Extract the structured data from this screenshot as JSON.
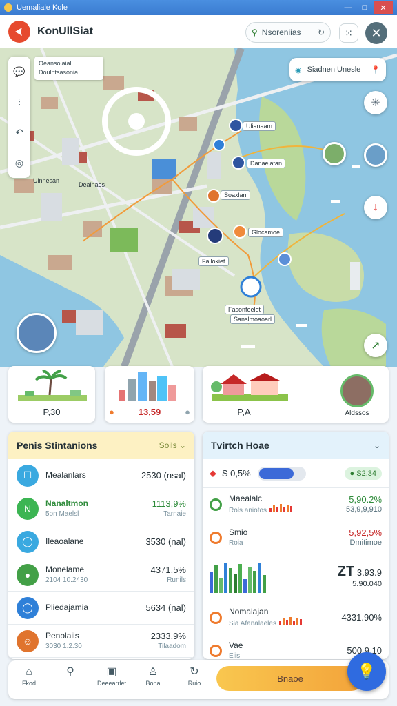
{
  "window": {
    "title": "Uemaliale Kole",
    "min": "—",
    "max": "□",
    "close": "✕"
  },
  "appbar": {
    "name": "KonUllSiat",
    "search_text": "Nsoreniias",
    "grid_icon": "grid-icon",
    "close_icon": "close-icon"
  },
  "map": {
    "tooltip_lines": [
      "Oeansolaial",
      "Doulntsasonia"
    ],
    "status_pill": "Siadnen Unesle",
    "labels": [
      "Ulianaam",
      "Danaelatan",
      "Soaxlan",
      "Glocamoe",
      "Fallokiet",
      "Fasonfeelot",
      "Sanslmoaoarl"
    ],
    "side_labels": [
      "Ulnnesan",
      "Dealnaes"
    ]
  },
  "cards": [
    {
      "label": "P,30",
      "icon": "palm-tree-icon"
    },
    {
      "label": "13,59",
      "icon": "city-skyline-icon"
    },
    {
      "label": "P,A",
      "icon": "house-icon"
    },
    {
      "label": "Aldssos",
      "icon": "avatar-icon"
    }
  ],
  "left_panel": {
    "title": "Penis Stintanions",
    "sort_label": "Soils",
    "rows": [
      {
        "name": "Mealanlars",
        "sub": "",
        "value": "2530 (nsal)",
        "vsub": "",
        "color": "#3aa9e0"
      },
      {
        "name": "Nanaltmon",
        "sub": "5on Maelsl",
        "value": "1113,9%",
        "vsub": "Tarnaie",
        "color": "#3cb553",
        "highlight": true
      },
      {
        "name": "Ileaoalane",
        "sub": "",
        "value": "3530 (nal)",
        "vsub": "",
        "color": "#3aa9e0"
      },
      {
        "name": "Monelame",
        "sub": "2104 10.2430",
        "value": "4371.5%",
        "vsub": "Runils",
        "color": "#43a047"
      },
      {
        "name": "Pliedajamia",
        "sub": "",
        "value": "5634 (nal)",
        "vsub": "",
        "color": "#2f80d8"
      },
      {
        "name": "Penolaiis",
        "sub": "3030 1.2.30",
        "value": "2333.9%",
        "vsub": "Tilaadom",
        "color": "#e0742e"
      }
    ]
  },
  "right_panel": {
    "title": "Tvirtch Hoae",
    "top_value": "S 0,5%",
    "top_pill_right": "S2.34",
    "rows": [
      {
        "name": "Maealalc",
        "sub": "Rols aniotos",
        "value": "5,90.2%",
        "vsub": "53,9,9,910",
        "ring": "#43a047",
        "bars": "mixed"
      },
      {
        "name": "Smio",
        "sub": "Roia",
        "value": "5,92,5%",
        "vsub": "Dmitimoe",
        "ring": "#ef7b2e"
      },
      {
        "name": "ZT",
        "sub": "",
        "value": "3.93.9",
        "vsub": "5.90.040",
        "ring": "",
        "chart": true
      },
      {
        "name": "Nomalajan",
        "sub": "Sia Afanalaeles",
        "value": "4331.90%",
        "vsub": "",
        "ring": "#ef7b2e"
      },
      {
        "name": "Vae",
        "sub": "Eiis",
        "value": "500.9.10",
        "vsub": "",
        "ring": "#ef7b2e"
      }
    ]
  },
  "bottom_nav": {
    "items": [
      {
        "label": "Fkod",
        "icon": "home-icon"
      },
      {
        "label": "",
        "icon": "search-icon"
      },
      {
        "label": "Deeearrlet",
        "icon": "doc-icon"
      },
      {
        "label": "Bona",
        "icon": "person-icon"
      },
      {
        "label": "Ruio",
        "icon": "refresh-icon"
      }
    ],
    "cta": "Bnaoe",
    "fab_icon": "bulb-icon"
  }
}
